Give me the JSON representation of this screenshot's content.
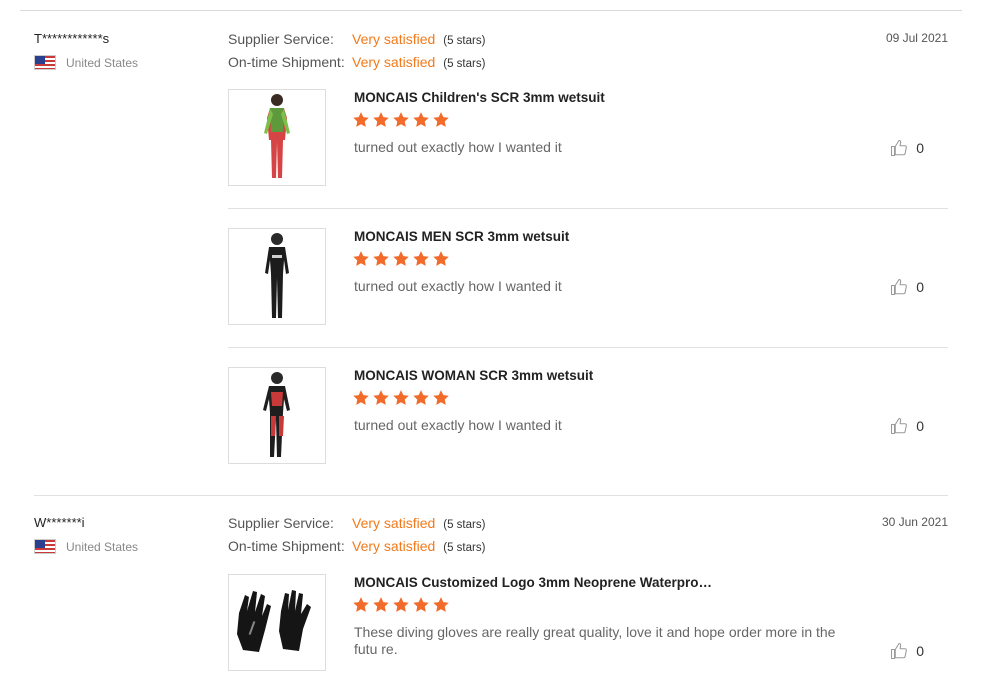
{
  "colors": {
    "accent": "#f27a1a",
    "star": "#f26b2b"
  },
  "reviews": [
    {
      "reviewer": "T************s",
      "country": "United States",
      "date": "09 Jul 2021",
      "supplier_service": {
        "label": "Supplier Service:",
        "value": "Very satisfied",
        "stars": "(5 stars)"
      },
      "on_time_shipment": {
        "label": "On-time Shipment:",
        "value": "Very satisfied",
        "stars": "(5 stars)"
      },
      "items": [
        {
          "title": "MONCAIS Children's SCR 3mm wetsuit",
          "rating": 5,
          "text": "turned out exactly how I wanted it",
          "likes": "0",
          "image_icon": "child-wetsuit-icon"
        },
        {
          "title": "MONCAIS MEN SCR 3mm wetsuit",
          "rating": 5,
          "text": "turned out exactly how I wanted it",
          "likes": "0",
          "image_icon": "men-wetsuit-icon"
        },
        {
          "title": "MONCAIS WOMAN SCR 3mm wetsuit",
          "rating": 5,
          "text": "turned out exactly how I wanted it",
          "likes": "0",
          "image_icon": "woman-wetsuit-icon"
        }
      ]
    },
    {
      "reviewer": "W*******i",
      "country": "United States",
      "date": "30 Jun 2021",
      "supplier_service": {
        "label": "Supplier Service:",
        "value": "Very satisfied",
        "stars": "(5 stars)"
      },
      "on_time_shipment": {
        "label": "On-time Shipment:",
        "value": "Very satisfied",
        "stars": "(5 stars)"
      },
      "items": [
        {
          "title": "MONCAIS Customized Logo 3mm Neoprene Waterpro…",
          "rating": 5,
          "text": "These diving gloves are really great quality, love it and hope order more in the futu re.",
          "likes": "0",
          "image_icon": "gloves-icon"
        }
      ]
    }
  ]
}
